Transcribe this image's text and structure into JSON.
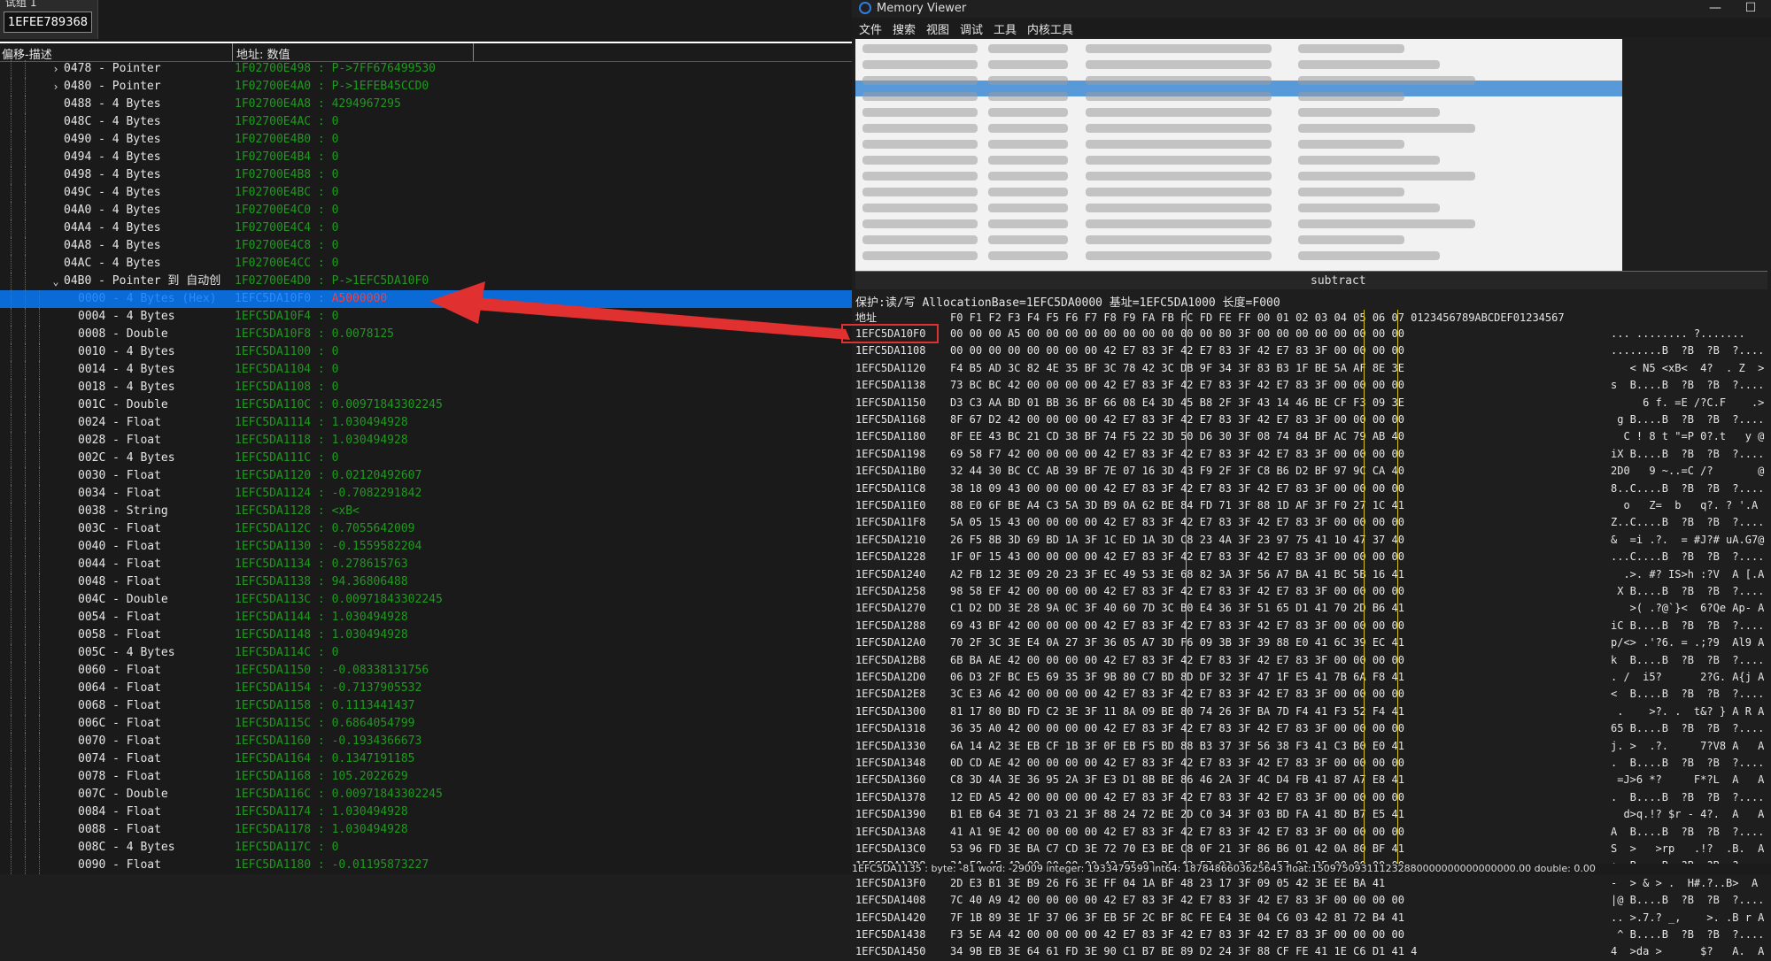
{
  "address_group": {
    "label": "试组 1",
    "value": "1EFEE789368"
  },
  "left_header": {
    "col1": "偏移-描述",
    "col2": "地址: 数值"
  },
  "rows": [
    {
      "indent": 2,
      "twist": "›",
      "desc": "0478 - Pointer",
      "val": "1F02700E498 : P->7FF676499530"
    },
    {
      "indent": 2,
      "twist": "›",
      "desc": "0480 - Pointer",
      "val": "1F02700E4A0 : P->1EFEB45CCD0"
    },
    {
      "indent": 2,
      "twist": "",
      "desc": "0488 - 4 Bytes",
      "val": "1F02700E4A8 : 4294967295"
    },
    {
      "indent": 2,
      "twist": "",
      "desc": "048C - 4 Bytes",
      "val": "1F02700E4AC : 0"
    },
    {
      "indent": 2,
      "twist": "",
      "desc": "0490 - 4 Bytes",
      "val": "1F02700E4B0 : 0"
    },
    {
      "indent": 2,
      "twist": "",
      "desc": "0494 - 4 Bytes",
      "val": "1F02700E4B4 : 0"
    },
    {
      "indent": 2,
      "twist": "",
      "desc": "0498 - 4 Bytes",
      "val": "1F02700E4B8 : 0"
    },
    {
      "indent": 2,
      "twist": "",
      "desc": "049C - 4 Bytes",
      "val": "1F02700E4BC : 0"
    },
    {
      "indent": 2,
      "twist": "",
      "desc": "04A0 - 4 Bytes",
      "val": "1F02700E4C0 : 0"
    },
    {
      "indent": 2,
      "twist": "",
      "desc": "04A4 - 4 Bytes",
      "val": "1F02700E4C4 : 0"
    },
    {
      "indent": 2,
      "twist": "",
      "desc": "04A8 - 4 Bytes",
      "val": "1F02700E4C8 : 0"
    },
    {
      "indent": 2,
      "twist": "",
      "desc": "04AC - 4 Bytes",
      "val": "1F02700E4CC : 0"
    },
    {
      "indent": 2,
      "twist": "⌄",
      "desc": "04B0 - Pointer 到 自动创",
      "val": "1F02700E4D0 : P->1EFC5DA10F0"
    },
    {
      "indent": 3,
      "twist": "",
      "desc": "0000 - 4 Bytes (Hex)",
      "val_a": "1EFC5DA10F0 : ",
      "val_b": "A5000000",
      "selected": true
    },
    {
      "indent": 3,
      "twist": "",
      "desc": "0004 - 4 Bytes",
      "val": "1EFC5DA10F4 : 0"
    },
    {
      "indent": 3,
      "twist": "",
      "desc": "0008 - Double",
      "val": "1EFC5DA10F8 : 0.0078125"
    },
    {
      "indent": 3,
      "twist": "",
      "desc": "0010 - 4 Bytes",
      "val": "1EFC5DA1100 : 0"
    },
    {
      "indent": 3,
      "twist": "",
      "desc": "0014 - 4 Bytes",
      "val": "1EFC5DA1104 : 0"
    },
    {
      "indent": 3,
      "twist": "",
      "desc": "0018 - 4 Bytes",
      "val": "1EFC5DA1108 : 0"
    },
    {
      "indent": 3,
      "twist": "",
      "desc": "001C - Double",
      "val": "1EFC5DA110C : 0.00971843302245"
    },
    {
      "indent": 3,
      "twist": "",
      "desc": "0024 - Float",
      "val": "1EFC5DA1114 : 1.030494928"
    },
    {
      "indent": 3,
      "twist": "",
      "desc": "0028 - Float",
      "val": "1EFC5DA1118 : 1.030494928"
    },
    {
      "indent": 3,
      "twist": "",
      "desc": "002C - 4 Bytes",
      "val": "1EFC5DA111C : 0"
    },
    {
      "indent": 3,
      "twist": "",
      "desc": "0030 - Float",
      "val": "1EFC5DA1120 : 0.02120492607"
    },
    {
      "indent": 3,
      "twist": "",
      "desc": "0034 - Float",
      "val": "1EFC5DA1124 : -0.7082291842"
    },
    {
      "indent": 3,
      "twist": "",
      "desc": "0038 - String",
      "val": "1EFC5DA1128 : <xB<"
    },
    {
      "indent": 3,
      "twist": "",
      "desc": "003C - Float",
      "val": "1EFC5DA112C : 0.7055642009"
    },
    {
      "indent": 3,
      "twist": "",
      "desc": "0040 - Float",
      "val": "1EFC5DA1130 : -0.1559582204"
    },
    {
      "indent": 3,
      "twist": "",
      "desc": "0044 - Float",
      "val": "1EFC5DA1134 : 0.278615763"
    },
    {
      "indent": 3,
      "twist": "",
      "desc": "0048 - Float",
      "val": "1EFC5DA1138 : 94.36806488"
    },
    {
      "indent": 3,
      "twist": "",
      "desc": "004C - Double",
      "val": "1EFC5DA113C : 0.00971843302245"
    },
    {
      "indent": 3,
      "twist": "",
      "desc": "0054 - Float",
      "val": "1EFC5DA1144 : 1.030494928"
    },
    {
      "indent": 3,
      "twist": "",
      "desc": "0058 - Float",
      "val": "1EFC5DA1148 : 1.030494928"
    },
    {
      "indent": 3,
      "twist": "",
      "desc": "005C - 4 Bytes",
      "val": "1EFC5DA114C : 0"
    },
    {
      "indent": 3,
      "twist": "",
      "desc": "0060 - Float",
      "val": "1EFC5DA1150 : -0.08338131756"
    },
    {
      "indent": 3,
      "twist": "",
      "desc": "0064 - Float",
      "val": "1EFC5DA1154 : -0.7137905532"
    },
    {
      "indent": 3,
      "twist": "",
      "desc": "0068 - Float",
      "val": "1EFC5DA1158 : 0.1113441437"
    },
    {
      "indent": 3,
      "twist": "",
      "desc": "006C - Float",
      "val": "1EFC5DA115C : 0.6864054799"
    },
    {
      "indent": 3,
      "twist": "",
      "desc": "0070 - Float",
      "val": "1EFC5DA1160 : -0.1934366673"
    },
    {
      "indent": 3,
      "twist": "",
      "desc": "0074 - Float",
      "val": "1EFC5DA1164 : 0.1347191185"
    },
    {
      "indent": 3,
      "twist": "",
      "desc": "0078 - Float",
      "val": "1EFC5DA1168 : 105.2022629"
    },
    {
      "indent": 3,
      "twist": "",
      "desc": "007C - Double",
      "val": "1EFC5DA116C : 0.00971843302245"
    },
    {
      "indent": 3,
      "twist": "",
      "desc": "0084 - Float",
      "val": "1EFC5DA1174 : 1.030494928"
    },
    {
      "indent": 3,
      "twist": "",
      "desc": "0088 - Float",
      "val": "1EFC5DA1178 : 1.030494928"
    },
    {
      "indent": 3,
      "twist": "",
      "desc": "008C - 4 Bytes",
      "val": "1EFC5DA117C : 0"
    },
    {
      "indent": 3,
      "twist": "",
      "desc": "0090 - Float",
      "val": "1EFC5DA1180 : -0.01195873227"
    }
  ],
  "memory_viewer": {
    "title": "Memory Viewer",
    "min_button": "—",
    "max_button": "☐",
    "menu": [
      "文件",
      "搜索",
      "视图",
      "调试",
      "工具",
      "内核工具"
    ],
    "subtract_label": "subtract",
    "info_line": "保护:读/写  AllocationBase=1EFC5DA0000  基址=1EFC5DA1000  长度=F000",
    "hex_header_label": "地址",
    "hex_header_cols": "F0 F1 F2 F3 F4 F5 F6 F7 F8 F9 FA FB FC FD FE FF 00 01 02 03 04 05 06 07 0123456789ABCDEF01234567",
    "hex_rows": [
      {
        "addr": "1EFC5DA10F0",
        "bytes": "00 00 00 A5 00 00 00 00 00 00 00 00 00 00 80 3F 00 00 00 00 00 00 00 00",
        "ascii": "... ........ ?......."
      },
      {
        "addr": "1EFC5DA1108",
        "bytes": "00 00 00 00 00 00 00 00 42 E7 83 3F 42 E7 83 3F 42 E7 83 3F 00 00 00 00",
        "ascii": "........B  ?B  ?B  ?...."
      },
      {
        "addr": "1EFC5DA1120",
        "bytes": "F4 B5 AD 3C 82 4E 35 BF 3C 78 42 3C DB 9F 34 3F 83 B3 1F BE 5A AF 8E 3E",
        "ascii": "   < N5 <xB<  4?  . Z  >"
      },
      {
        "addr": "1EFC5DA1138",
        "bytes": "73 BC BC 42 00 00 00 00 42 E7 83 3F 42 E7 83 3F 42 E7 83 3F 00 00 00 00",
        "ascii": "s  B....B  ?B  ?B  ?...."
      },
      {
        "addr": "1EFC5DA1150",
        "bytes": "D3 C3 AA BD 01 BB 36 BF 66 08 E4 3D 45 B8 2F 3F 43 14 46 BE CF F3 09 3E",
        "ascii": "     6 f. =E /?C.F    .>"
      },
      {
        "addr": "1EFC5DA1168",
        "bytes": "8F 67 D2 42 00 00 00 00 42 E7 83 3F 42 E7 83 3F 42 E7 83 3F 00 00 00 00",
        "ascii": " g B....B  ?B  ?B  ?...."
      },
      {
        "addr": "1EFC5DA1180",
        "bytes": "8F EE 43 BC 21 CD 38 BF 74 F5 22 3D 50 D6 30 3F 08 74 84 BF AC 79 AB 40",
        "ascii": "  C ! 8 t \"=P 0?.t   y @"
      },
      {
        "addr": "1EFC5DA1198",
        "bytes": "69 58 F7 42 00 00 00 00 42 E7 83 3F 42 E7 83 3F 42 E7 83 3F 00 00 00 00",
        "ascii": "iX B....B  ?B  ?B  ?...."
      },
      {
        "addr": "1EFC5DA11B0",
        "bytes": "32 44 30 BC CC AB 39 BF 7E 07 16 3D 43 F9 2F 3F C8 B6 D2 BF 97 9C CA 40",
        "ascii": "2D0   9 ~..=C /?       @"
      },
      {
        "addr": "1EFC5DA11C8",
        "bytes": "38 18 09 43 00 00 00 00 42 E7 83 3F 42 E7 83 3F 42 E7 83 3F 00 00 00 00",
        "ascii": "8..C....B  ?B  ?B  ?...."
      },
      {
        "addr": "1EFC5DA11E0",
        "bytes": "88 E0 6F BE A4 C3 5A 3D B9 0A 62 BE 84 FD 71 3F 88 1D AF 3F F0 27 1C 41",
        "ascii": "  o   Z=  b   q?. ? '.A"
      },
      {
        "addr": "1EFC5DA11F8",
        "bytes": "5A 05 15 43 00 00 00 00 42 E7 83 3F 42 E7 83 3F 42 E7 83 3F 00 00 00 00",
        "ascii": "Z..C....B  ?B  ?B  ?...."
      },
      {
        "addr": "1EFC5DA1210",
        "bytes": "26 F5 8B 3D 69 BD 1A 3F 1C ED 1A 3D C8 23 4A 3F 23 97 75 41 10 47 37 40",
        "ascii": "&  =i .?.  = #J?# uA.G7@"
      },
      {
        "addr": "1EFC5DA1228",
        "bytes": "1F 0F 15 43 00 00 00 00 42 E7 83 3F 42 E7 83 3F 42 E7 83 3F 00 00 00 00",
        "ascii": "...C....B  ?B  ?B  ?...."
      },
      {
        "addr": "1EFC5DA1240",
        "bytes": "A2 FB 12 3E 09 20 23 3F EC 49 53 3E 68 82 3A 3F 56 A7 BA 41 BC 5B 16 41",
        "ascii": "  .>. #? IS>h :?V  A [.A"
      },
      {
        "addr": "1EFC5DA1258",
        "bytes": "98 58 EF 42 00 00 00 00 42 E7 83 3F 42 E7 83 3F 42 E7 83 3F 00 00 00 00",
        "ascii": " X B....B  ?B  ?B  ?...."
      },
      {
        "addr": "1EFC5DA1270",
        "bytes": "C1 D2 DD 3E 28 9A 0C 3F 40 60 7D 3C B0 E4 36 3F 51 65 D1 41 70 2D B6 41",
        "ascii": "   >( .?@`}<  6?Qe Ap- A"
      },
      {
        "addr": "1EFC5DA1288",
        "bytes": "69 43 BF 42 00 00 00 00 42 E7 83 3F 42 E7 83 3F 42 E7 83 3F 00 00 00 00",
        "ascii": "iC B....B  ?B  ?B  ?...."
      },
      {
        "addr": "1EFC5DA12A0",
        "bytes": "70 2F 3C 3E E4 0A 27 3F 36 05 A7 3D F6 09 3B 3F 39 88 E0 41 6C 39 EC 41",
        "ascii": "p/<> .'?6. = .;?9  Al9 A"
      },
      {
        "addr": "1EFC5DA12B8",
        "bytes": "6B BA AE 42 00 00 00 00 42 E7 83 3F 42 E7 83 3F 42 E7 83 3F 00 00 00 00",
        "ascii": "k  B....B  ?B  ?B  ?...."
      },
      {
        "addr": "1EFC5DA12D0",
        "bytes": "06 D3 2F BC E5 69 35 3F 9B 80 C7 BD 8D DF 32 3F 47 1F E5 41 7B 6A F8 41",
        "ascii": ". /  i5?      2?G. A{j A"
      },
      {
        "addr": "1EFC5DA12E8",
        "bytes": "3C E3 A6 42 00 00 00 00 42 E7 83 3F 42 E7 83 3F 42 E7 83 3F 00 00 00 00",
        "ascii": "<  B....B  ?B  ?B  ?...."
      },
      {
        "addr": "1EFC5DA1300",
        "bytes": "81 17 80 BD FD C2 3E 3F 11 8A 09 BE 80 74 26 3F BA 7D F4 41 F3 52 F4 41",
        "ascii": " .    >?. .  t&? } A R A"
      },
      {
        "addr": "1EFC5DA1318",
        "bytes": "36 35 A0 42 00 00 00 00 42 E7 83 3F 42 E7 83 3F 42 E7 83 3F 00 00 00 00",
        "ascii": "65 B....B  ?B  ?B  ?...."
      },
      {
        "addr": "1EFC5DA1330",
        "bytes": "6A 14 A2 3E EB CF 1B 3F 0F EB F5 BD 88 B3 37 3F 56 38 F3 41 C3 B0 E0 41",
        "ascii": "j. >  .?.     7?V8 A   A"
      },
      {
        "addr": "1EFC5DA1348",
        "bytes": "0D CD AE 42 00 00 00 00 42 E7 83 3F 42 E7 83 3F 42 E7 83 3F 00 00 00 00",
        "ascii": ".  B....B  ?B  ?B  ?...."
      },
      {
        "addr": "1EFC5DA1360",
        "bytes": "C8 3D 4A 3E 36 95 2A 3F E3 D1 8B BE 86 46 2A 3F 4C D4 FB 41 87 A7 E8 41",
        "ascii": " =J>6 *?     F*?L  A   A"
      },
      {
        "addr": "1EFC5DA1378",
        "bytes": "12 ED A5 42 00 00 00 00 42 E7 83 3F 42 E7 83 3F 42 E7 83 3F 00 00 00 00",
        "ascii": ".  B....B  ?B  ?B  ?...."
      },
      {
        "addr": "1EFC5DA1390",
        "bytes": "B1 EB 64 3E 71 03 21 3F 88 24 72 BE 2D C0 34 3F 03 BD FA 41 8D B7 E5 41",
        "ascii": "  d>q.!? $r - 4?.  A   A"
      },
      {
        "addr": "1EFC5DA13A8",
        "bytes": "41 A1 9E 42 00 00 00 00 42 E7 83 3F 42 E7 83 3F 42 E7 83 3F 00 00 00 00",
        "ascii": "A  B....B  ?B  ?B  ?...."
      },
      {
        "addr": "1EFC5DA13C0",
        "bytes": "53 96 FD 3E BA C7 CD 3E 72 70 E3 BE C8 0F 21 3F 86 B6 01 42 0A 80 BF 41",
        "ascii": "S  >   >rp   .!?  .B.  A"
      },
      {
        "addr": "1EFC5DA13D8",
        "bytes": "3A F8 AF 42 00 00 00 00 42 E7 83 3F 42 E7 83 3F 42 E7 83 3F 00 00 00 00",
        "ascii": ":  B....B  ?B  ?B  ?...."
      },
      {
        "addr": "1EFC5DA13F0",
        "bytes": "2D E3 B1 3E B9 26 F6 3E FF 04 1A BF 48 23 17 3F 09 05 42 3E EE BA 41",
        "ascii": "-  > & > .  H#.?..B>  A"
      },
      {
        "addr": "1EFC5DA1408",
        "bytes": "7C 40 A9 42 00 00 00 00 42 E7 83 3F 42 E7 83 3F 42 E7 83 3F 00 00 00 00",
        "ascii": "|@ B....B  ?B  ?B  ?...."
      },
      {
        "addr": "1EFC5DA1420",
        "bytes": "7F 1B 89 3E 1F 37 06 3F EB 5F 2C BF 8C FE E4 3E 04 C6 03 42 81 72 B4 41",
        "ascii": ".. >.7.? _,    >. .B r A"
      },
      {
        "addr": "1EFC5DA1438",
        "bytes": "F3 5E A4 42 00 00 00 00 42 E7 83 3F 42 E7 83 3F 42 E7 83 3F 00 00 00 00",
        "ascii": " ^ B....B  ?B  ?B  ?...."
      },
      {
        "addr": "1EFC5DA1450",
        "bytes": "34 9B EB 3E 64 61 FD 3E 90 C1 B7 BE 89 D2 24 3F 88 CF FE 41 1E C6 D1 41 4",
        "ascii": "4  >da >      $?   A.  A"
      }
    ],
    "status": "1EFC5DA1135 : byte: -81 word: -29009 integer: 1933479599 int64: 1878486603625643 float:150975093111232880000000000000000.00 double: 0.00"
  },
  "colors": {
    "selection": "#0a6ad6",
    "value_green": "#1f9a1f",
    "arrow": "#e03030"
  }
}
